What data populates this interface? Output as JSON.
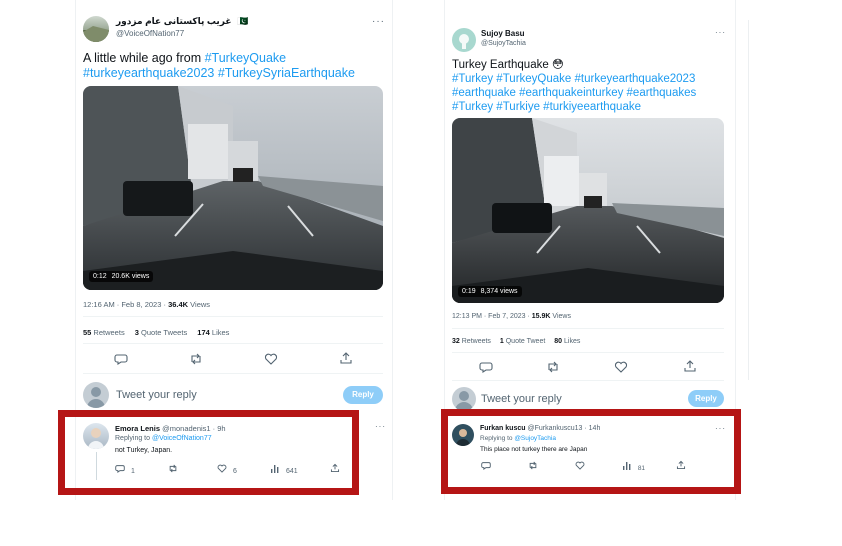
{
  "left": {
    "author_name": "غریب پاکستانی عام مزدور",
    "flag": "🇵🇰",
    "handle": "@VoiceOfNation77",
    "more": "···",
    "text_prefix": "A little while ago from",
    "hashtags_line1": "#TurkeyQuake",
    "hashtags_line2": "#turkeyearthquake2023 #TurkeySyriaEarthquake",
    "video_time": "0:12",
    "video_views": "20.6K views",
    "timestamp": "12:16 AM · Feb 8, 2023 · ",
    "views_count": "36.4K",
    "views_label": " Views",
    "retweets_count": "55",
    "retweets_label": " Retweets",
    "quotes_count": "3",
    "quotes_label": " Quote Tweets",
    "likes_count": "174",
    "likes_label": " Likes",
    "reply_placeholder": "Tweet your reply",
    "reply_button": "Reply",
    "comment": {
      "name": "Emora Lenis",
      "handle": "@monadenis1 · 9h",
      "replying_prefix": "Replying to ",
      "replying_handle": "@VoiceOfNation77",
      "text": "not Turkey, Japan.",
      "replies": "1",
      "likes": "6",
      "views": "641",
      "more": "···"
    }
  },
  "right": {
    "author_name": "Sujoy Basu",
    "handle": "@SujoyTachia",
    "more": "···",
    "text_line1": "Turkey Earthquake 😳",
    "hashtags_line1": "#Turkey #TurkeyQuake #turkeyearthquake2023",
    "hashtags_line2": "#earthquake #earthquakeinturkey #earthquakes",
    "hashtags_line3": "#Turkey #Turkiye #turkiyeearthquake",
    "video_time": "0:19",
    "video_views": "8,374 views",
    "timestamp": "12:13 PM · Feb 7, 2023 · ",
    "views_count": "15.9K",
    "views_label": " Views",
    "retweets_count": "32",
    "retweets_label": " Retweets",
    "quotes_count": "1",
    "quotes_label": " Quote Tweet",
    "likes_count": "80",
    "likes_label": " Likes",
    "reply_placeholder": "Tweet your reply",
    "reply_button": "Reply",
    "comment": {
      "name": "Furkan kuscu",
      "handle": "@Furkankuscu13 · 14h",
      "replying_prefix": "Replying to ",
      "replying_handle": "@SujoyTachia",
      "text": "This place not turkey there are Japan",
      "views": "81",
      "more": "···"
    }
  },
  "colors": {
    "highlight_border": "#b51515",
    "link": "#1d9bf0",
    "reply_button": "#8ecdf8"
  }
}
